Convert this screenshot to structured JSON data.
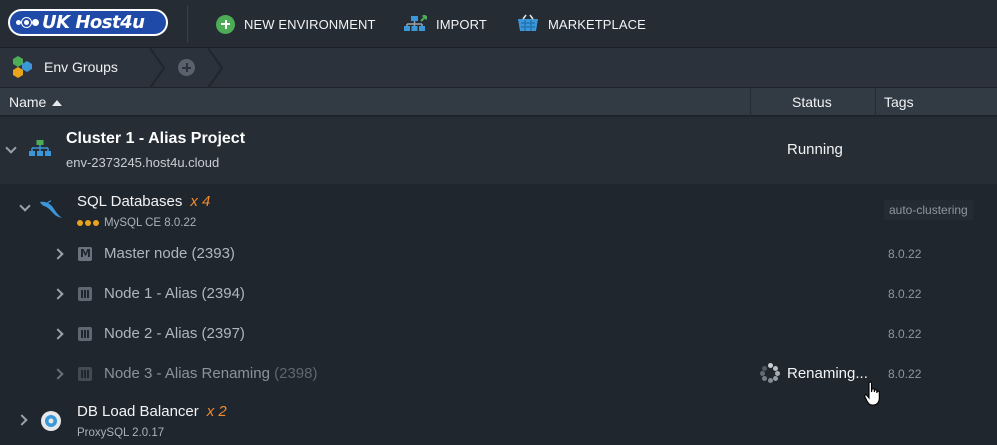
{
  "toolbar": {
    "logo_text": "UK Host4u",
    "new_environment_label": "NEW ENVIRONMENT",
    "import_label": "IMPORT",
    "marketplace_label": "MARKETPLACE"
  },
  "breadcrumb": {
    "env_groups_label": "Env Groups"
  },
  "columns": {
    "name": "Name",
    "status": "Status",
    "tags": "Tags"
  },
  "environment": {
    "title": "Cluster 1 - Alias Project",
    "domain": "env-2373245.host4u.cloud",
    "status": "Running"
  },
  "groups": [
    {
      "title": "SQL Databases",
      "count": "x 4",
      "subtitle": "MySQL CE 8.0.22",
      "tag": "auto-clustering",
      "icon": "mysql-dolphin-icon"
    },
    {
      "title": "DB Load Balancer",
      "count": "x 2",
      "subtitle": "ProxySQL 2.0.17",
      "icon": "proxysql-icon"
    }
  ],
  "nodes": [
    {
      "name": "Master node (2393)",
      "version": "8.0.22",
      "icon": "master-node-icon"
    },
    {
      "name": "Node 1 - Alias (2394)",
      "version": "8.0.22",
      "icon": "node-icon"
    },
    {
      "name": "Node 2 - Alias (2397)",
      "version": "8.0.22",
      "icon": "node-icon"
    },
    {
      "name_main": "Node 3 - Alias Renaming",
      "name_id": "(2398)",
      "version": "8.0.22",
      "status": "Renaming...",
      "icon": "node-icon"
    }
  ],
  "colors": {
    "accent_green": "#4dac56",
    "count_orange": "#f08a2c",
    "logo_blue": "#1f4aa8"
  }
}
